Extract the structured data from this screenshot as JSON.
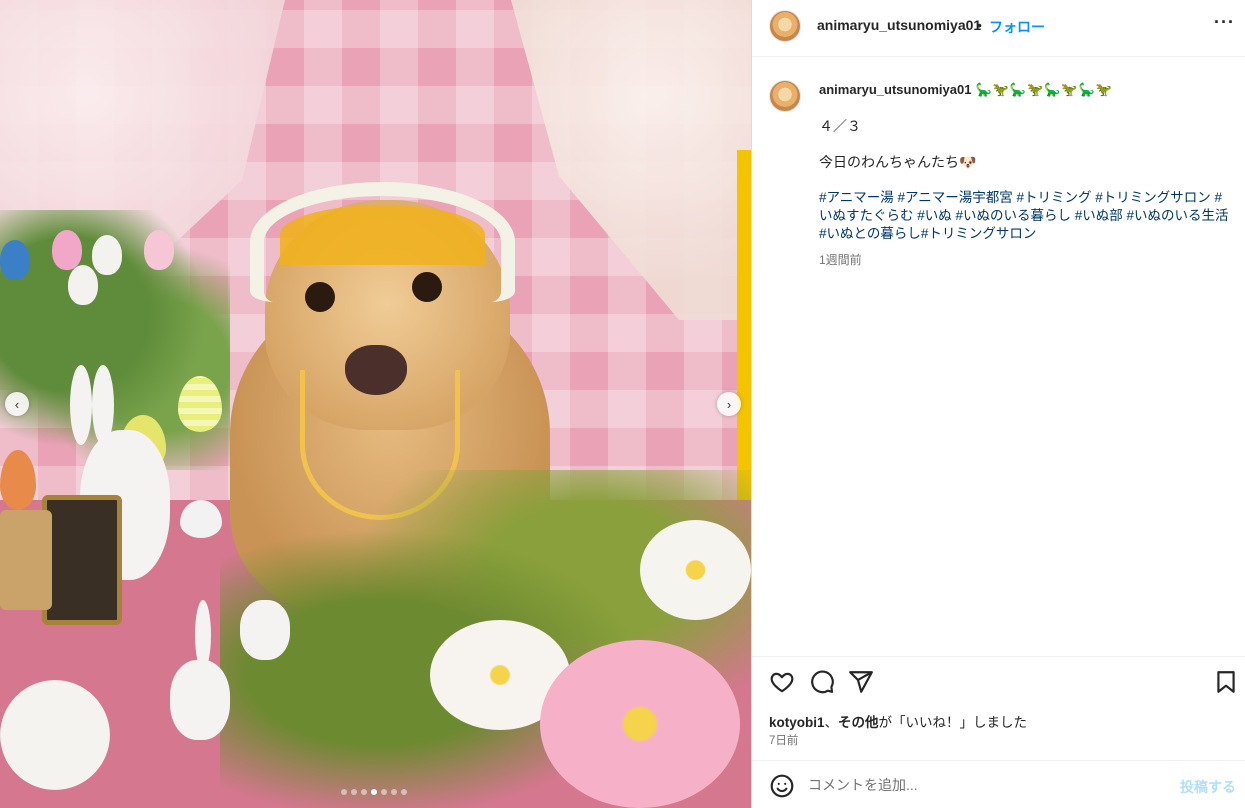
{
  "post": {
    "username": "animaryu_utsunomiya01",
    "separator": "•",
    "follow_label": "フォロー",
    "more_icon": "more-horizontal-icon"
  },
  "caption": {
    "username": "animaryu_utsunomiya01",
    "dinos": "🦕🦖🦕🦖🦕🦖🦕🦖",
    "line1": "４／３",
    "line2": "今日のわんちゃんたち🐶",
    "hashtags": "#アニマー湯 #アニマー湯宇都宮 #トリミング #トリミングサロン #いぬすたぐらむ #いぬ #いぬのいる暮らし #いぬ部 #いぬのいる生活 #いぬとの暮らし#トリミングサロン",
    "time_ago": "1週間前"
  },
  "likes": {
    "user": "kotyobi1",
    "comma": "、",
    "others": "その他",
    "text": "が「いいね！」しました",
    "date": "7日前"
  },
  "comment": {
    "placeholder": "コメントを追加...",
    "post_label": "投稿する"
  },
  "media": {
    "carousel_total": 7,
    "carousel_active": 4
  },
  "colors": {
    "accent": "#0095f6",
    "hashtag": "#00376b",
    "muted": "#737373",
    "post_disabled": "#b2dffc"
  }
}
